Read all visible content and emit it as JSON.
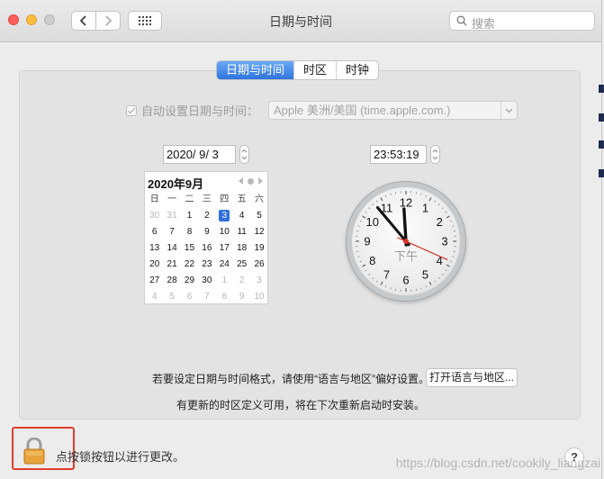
{
  "window": {
    "title": "日期与时间"
  },
  "search": {
    "placeholder": "搜索"
  },
  "tabs": [
    {
      "label": "日期与时间",
      "active": true
    },
    {
      "label": "时区",
      "active": false
    },
    {
      "label": "时钟",
      "active": false
    }
  ],
  "auto_set": {
    "label": "自动设置日期与时间：",
    "checked": true,
    "server": "Apple 美洲/美国 (time.apple.com.)"
  },
  "date_field": {
    "value": "2020/  9/  3"
  },
  "time_field": {
    "value": "23:53:19"
  },
  "calendar": {
    "month_title": "2020年9月",
    "weekdays": [
      "日",
      "一",
      "二",
      "三",
      "四",
      "五",
      "六"
    ],
    "weeks": [
      [
        {
          "d": "30",
          "dim": true
        },
        {
          "d": "31",
          "dim": true
        },
        {
          "d": "1"
        },
        {
          "d": "2"
        },
        {
          "d": "3",
          "sel": true
        },
        {
          "d": "4"
        },
        {
          "d": "5"
        }
      ],
      [
        {
          "d": "6"
        },
        {
          "d": "7"
        },
        {
          "d": "8"
        },
        {
          "d": "9"
        },
        {
          "d": "10"
        },
        {
          "d": "11"
        },
        {
          "d": "12"
        }
      ],
      [
        {
          "d": "13"
        },
        {
          "d": "14"
        },
        {
          "d": "15"
        },
        {
          "d": "16"
        },
        {
          "d": "17"
        },
        {
          "d": "18"
        },
        {
          "d": "19"
        }
      ],
      [
        {
          "d": "20"
        },
        {
          "d": "21"
        },
        {
          "d": "22"
        },
        {
          "d": "23"
        },
        {
          "d": "24"
        },
        {
          "d": "25"
        },
        {
          "d": "26"
        }
      ],
      [
        {
          "d": "27"
        },
        {
          "d": "28"
        },
        {
          "d": "29"
        },
        {
          "d": "30"
        },
        {
          "d": "1",
          "dim": true
        },
        {
          "d": "2",
          "dim": true
        },
        {
          "d": "3",
          "dim": true
        }
      ],
      [
        {
          "d": "4",
          "dim": true
        },
        {
          "d": "5",
          "dim": true
        },
        {
          "d": "6",
          "dim": true
        },
        {
          "d": "7",
          "dim": true
        },
        {
          "d": "8",
          "dim": true
        },
        {
          "d": "9",
          "dim": true
        },
        {
          "d": "10",
          "dim": true
        }
      ]
    ]
  },
  "clock": {
    "numbers": [
      "12",
      "1",
      "2",
      "3",
      "4",
      "5",
      "6",
      "7",
      "8",
      "9",
      "10",
      "11"
    ],
    "ampm": "下午",
    "hour": 23,
    "minute": 53,
    "second": 19
  },
  "format_note": {
    "text": "若要设定日期与时间格式，请使用“语言与地区”偏好设置。",
    "button": "打开语言与地区..."
  },
  "tz_note": "有更新的时区定义可用，将在下次重新启动时安装。",
  "lock": {
    "label": "点按锁按钮以进行更改。"
  },
  "help": {
    "label": "?"
  },
  "watermark": "https://blog.csdn.net/cookily_liangzai",
  "colors": {
    "accent": "#2f6fe0",
    "highlight_border": "#e03e2d",
    "second_hand": "#d9342b"
  }
}
